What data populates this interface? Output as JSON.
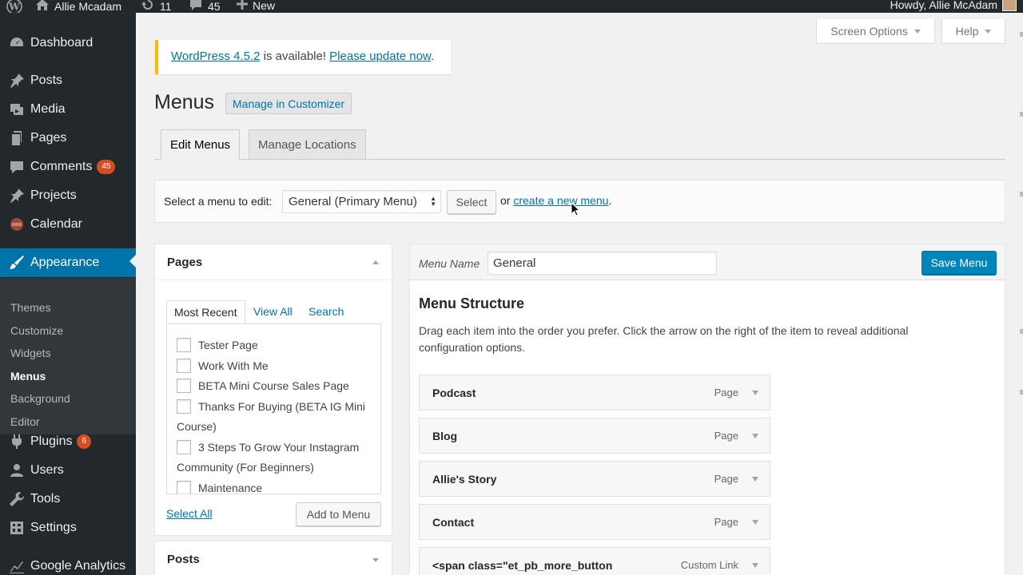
{
  "admin_bar": {
    "site_name": "Allie Mcadam",
    "updates_count": "11",
    "comments_count": "45",
    "new_label": "New",
    "greeting": "Howdy, Allie McAdam"
  },
  "sidebar": {
    "items": [
      {
        "label": "Dashboard",
        "icon": "dashboard-icon"
      },
      {
        "label": "Posts",
        "icon": "pin-icon"
      },
      {
        "label": "Media",
        "icon": "media-icon"
      },
      {
        "label": "Pages",
        "icon": "page-icon"
      },
      {
        "label": "Comments",
        "icon": "comment-icon",
        "badge": "45"
      },
      {
        "label": "Projects",
        "icon": "pin-icon"
      },
      {
        "label": "Calendar",
        "icon": "calendar-icon"
      },
      {
        "label": "Appearance",
        "icon": "brush-icon"
      },
      {
        "label": "Plugins",
        "icon": "plugin-icon",
        "badge": "6"
      },
      {
        "label": "Users",
        "icon": "users-icon"
      },
      {
        "label": "Tools",
        "icon": "wrench-icon"
      },
      {
        "label": "Settings",
        "icon": "settings-icon"
      },
      {
        "label": "Google Analytics",
        "icon": "chart-icon"
      }
    ],
    "appearance_submenu": [
      "Themes",
      "Customize",
      "Widgets",
      "Menus",
      "Background",
      "Editor"
    ]
  },
  "screen_options": "Screen Options",
  "help": "Help",
  "notice": {
    "version_link": "WordPress 4.5.2",
    "middle": " is available! ",
    "update_link": "Please update now",
    "end": "."
  },
  "page": {
    "title": "Menus",
    "customizer_button": "Manage in Customizer"
  },
  "tabs": {
    "edit": "Edit Menus",
    "locations": "Manage Locations"
  },
  "manage": {
    "label": "Select a menu to edit:",
    "selected": "General (Primary Menu)",
    "select_button": "Select",
    "or": "or",
    "create_link": "create a new menu",
    "period": "."
  },
  "pages_box": {
    "title": "Pages",
    "tabs": [
      "Most Recent",
      "View All",
      "Search"
    ],
    "items": [
      "Tester Page",
      "Work With Me",
      "BETA Mini Course Sales Page",
      "Thanks For Buying (BETA IG Mini Course)",
      "3 Steps To Grow Your Instagram Community (For Beginners)",
      "Maintenance"
    ],
    "select_all": "Select All",
    "add_button": "Add to Menu"
  },
  "posts_box": {
    "title": "Posts"
  },
  "menu_edit": {
    "name_label": "Menu Name",
    "name_value": "General",
    "save_button": "Save Menu",
    "structure_title": "Menu Structure",
    "instructions": "Drag each item into the order you prefer. Click the arrow on the right of the item to reveal additional configuration options.",
    "items": [
      {
        "title": "Podcast",
        "type": "Page"
      },
      {
        "title": "Blog",
        "type": "Page"
      },
      {
        "title": "Allie's Story",
        "type": "Page"
      },
      {
        "title": "Contact",
        "type": "Page"
      },
      {
        "title": "<span class=\"et_pb_more_button",
        "type": "Custom Link"
      }
    ]
  },
  "colors": {
    "accent": "#0073aa",
    "sidebar_bg": "#23282d",
    "badge": "#d54e21",
    "notice_border": "#ffb900",
    "primary_button": "#0085ba"
  }
}
